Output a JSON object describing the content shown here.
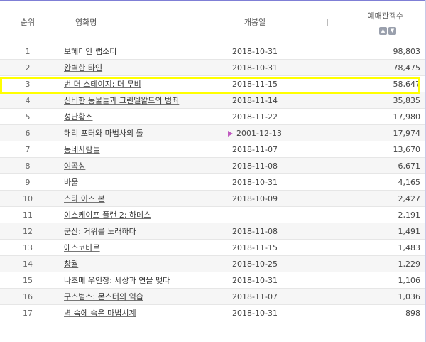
{
  "header": {
    "rank": "순위",
    "title": "영화명",
    "release_date": "개봉일",
    "audience": "예매관객수"
  },
  "sort_icons": [
    "sort-up-icon",
    "sort-down-icon"
  ],
  "highlight_color": "#ffff00",
  "rows": [
    {
      "rank": "1",
      "title": "보헤미안 랩소디",
      "date": "2018-10-31",
      "count": "98,803"
    },
    {
      "rank": "2",
      "title": "완벽한 타인",
      "date": "2018-10-31",
      "count": "78,475"
    },
    {
      "rank": "3",
      "title": "번 더 스테이지: 더 무비",
      "date": "2018-11-15",
      "count": "58,647"
    },
    {
      "rank": "4",
      "title": "신비한 동물들과 그린델왈드의 범죄",
      "date": "2018-11-14",
      "count": "35,835"
    },
    {
      "rank": "5",
      "title": "성난황소",
      "date": "2018-11-22",
      "count": "17,980"
    },
    {
      "rank": "6",
      "title": "해리 포터와 마법사의 돌",
      "date": "2001-12-13",
      "count": "17,974"
    },
    {
      "rank": "7",
      "title": "동네사람들",
      "date": "2018-11-07",
      "count": "13,670"
    },
    {
      "rank": "8",
      "title": "여곡성",
      "date": "2018-11-08",
      "count": "6,671"
    },
    {
      "rank": "9",
      "title": "바울",
      "date": "2018-10-31",
      "count": "4,165"
    },
    {
      "rank": "10",
      "title": "스타 이즈 본",
      "date": "2018-10-09",
      "count": "2,427"
    },
    {
      "rank": "11",
      "title": "이스케이프 플랜 2: 하데스",
      "date": "",
      "count": "2,191"
    },
    {
      "rank": "12",
      "title": "군산: 거위를 노래하다",
      "date": "2018-11-08",
      "count": "1,491"
    },
    {
      "rank": "13",
      "title": "에스코바르",
      "date": "2018-11-15",
      "count": "1,483"
    },
    {
      "rank": "14",
      "title": "창궐",
      "date": "2018-10-25",
      "count": "1,229"
    },
    {
      "rank": "15",
      "title": "나초메 우인장: 세상과 연을 맺다",
      "date": "2018-10-31",
      "count": "1,106"
    },
    {
      "rank": "16",
      "title": "구스범스: 몬스터의 역습",
      "date": "2018-11-07",
      "count": "1,036"
    },
    {
      "rank": "17",
      "title": "벽 속에 숨은 마법시계",
      "date": "2018-10-31",
      "count": "898"
    }
  ]
}
